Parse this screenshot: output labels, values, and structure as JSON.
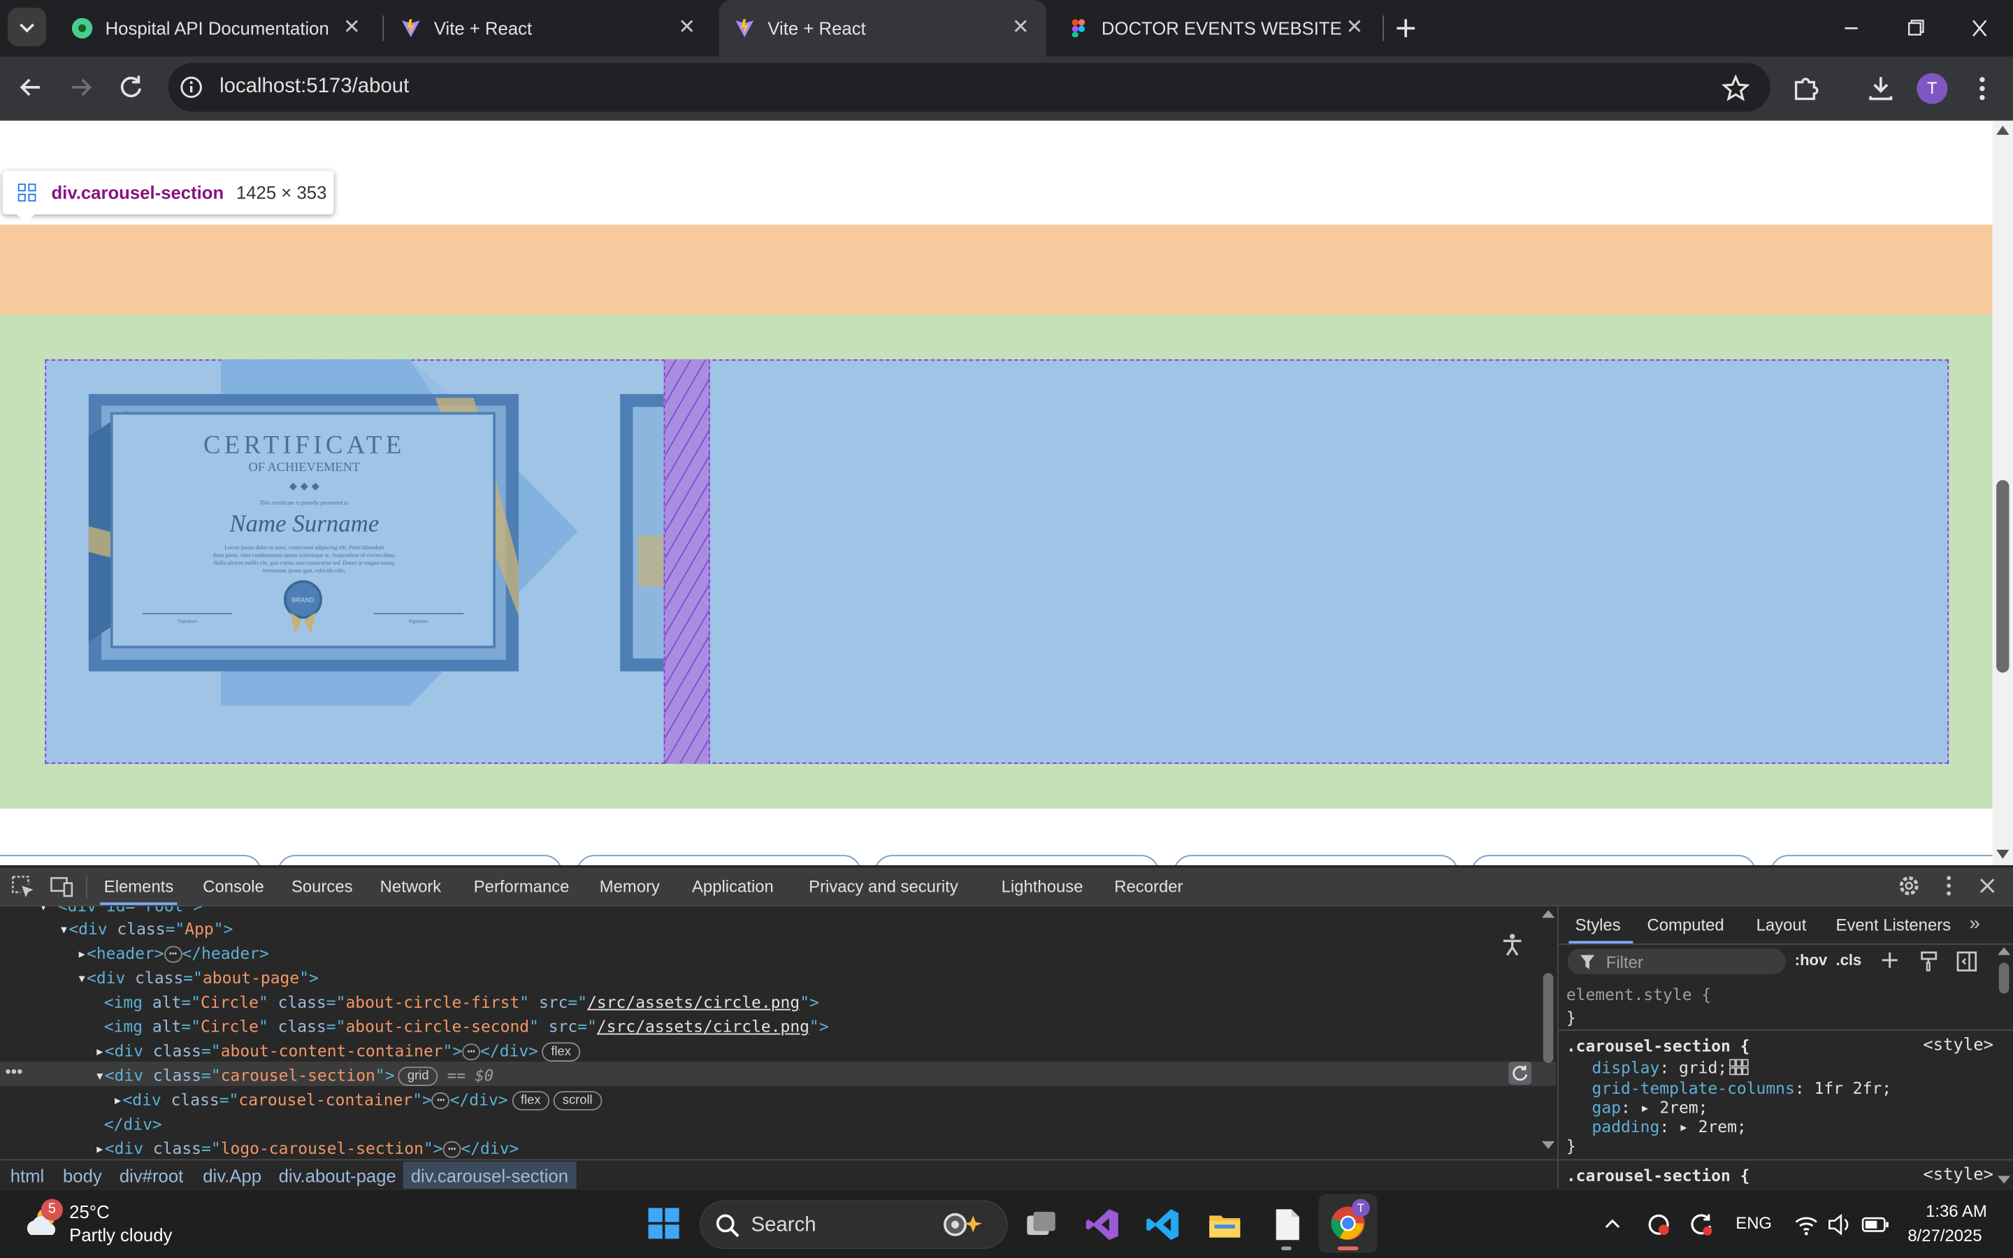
{
  "browser": {
    "tabs": [
      {
        "title": "Hospital API Documentation",
        "active": false
      },
      {
        "title": "Vite + React",
        "active": false
      },
      {
        "title": "Vite + React",
        "active": true
      },
      {
        "title": "DOCTOR EVENTS WEBSITE – Fig",
        "active": false
      }
    ],
    "url": "localhost:5173/about",
    "profile_initial": "T"
  },
  "page": {
    "inspect_tooltip": {
      "selector": "div.carousel-section",
      "size": "1425 × 353"
    },
    "certificate": {
      "title": "CERTIFICATE",
      "subtitle": "OF ACHIEVEMENT",
      "intro": "This certificate is proudly presented to",
      "name": "Name Surname",
      "body1": "Lorem ipsum dolor sit amet, consectetur adipiscing elit. Proin bibendum",
      "body2": "diam purus, vitae condimentum ipsum scelerisque ac. Suspendisse id viverra diam.",
      "body3": "Nulla ultrices mollis elit, quis cursus ante consectetur sed. Donec ut magna massa,",
      "body4": "fermentum ipsum quis, vehicula odio.",
      "seal": "BRAND",
      "sig_left": "Signature",
      "sig_right": "Signature"
    }
  },
  "devtools": {
    "tabs": [
      "Elements",
      "Console",
      "Sources",
      "Network",
      "Performance",
      "Memory",
      "Application",
      "Privacy and security",
      "Lighthouse",
      "Recorder"
    ],
    "active_tab": "Elements",
    "breadcrumbs": [
      "html",
      "body",
      "div#root",
      "div.App",
      "div.about-page",
      "div.carousel-section"
    ],
    "dom": {
      "root_line": "<div id=\"root\">",
      "app_open": "<div class=\"App\">",
      "header": "<header>",
      "header_close": "</header>",
      "about_open": "<div class=\"about-page\">",
      "img1_class": "about-circle-first",
      "img2_class": "about-circle-second",
      "img_alt": "Circle",
      "img_src": "/src/assets/circle.png",
      "content_class": "about-content-container",
      "carousel_section_class": "carousel-section",
      "selected_suffix": "== $0",
      "carousel_container_class": "carousel-container",
      "logo_class": "logo-carousel-section",
      "badge_flex": "flex",
      "badge_grid": "grid",
      "badge_scroll": "scroll"
    },
    "styles_tabs": [
      "Styles",
      "Computed",
      "Layout",
      "Event Listeners"
    ],
    "filter_placeholder": "Filter",
    "hov": ":hov",
    "cls": ".cls",
    "element_style": "element.style {",
    "rule_selector": ".carousel-section {",
    "rule_source": "<style>",
    "rule_props": [
      {
        "prop": "display",
        "val": "grid;"
      },
      {
        "prop": "grid-template-columns",
        "val": "1fr 2fr;"
      },
      {
        "prop": "gap",
        "val": "2rem;"
      },
      {
        "prop": "padding",
        "val": "2rem;"
      }
    ],
    "rule2_selector": ".carousel-section {",
    "rule2_source": "<style>"
  },
  "taskbar": {
    "weather_temp": "25°C",
    "weather_desc": "Partly cloudy",
    "weather_badge": "5",
    "search_label": "Search",
    "lang": "ENG",
    "time": "1:36 AM",
    "date": "8/27/2025"
  },
  "colors": {
    "peach_band": "#f8cb9f",
    "green_band": "#c5e1b8",
    "grid_overlay": "#9fc4e6",
    "gap_hatch": "#a98ee0",
    "grid_border": "#8e3ad6",
    "tab_active": "#35363a"
  }
}
